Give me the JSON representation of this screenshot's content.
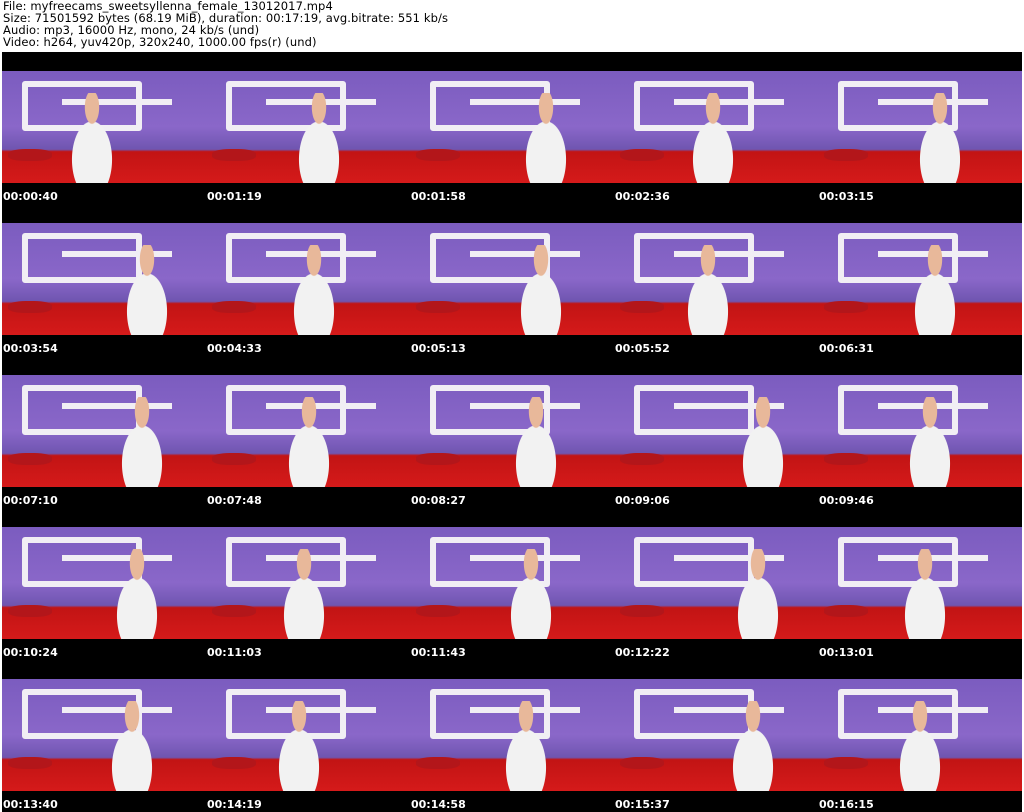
{
  "info": {
    "file": "File: myfreecams_sweetsyllenna_female_13012017.mp4",
    "size": "Size: 71501592 bytes (68.19 MiB), duration: 00:17:19, avg.bitrate: 551 kb/s",
    "audio": "Audio: mp3, 16000 Hz, mono, 24 kb/s (und)",
    "video": "Video: h264, yuv420p, 320x240, 1000.00 fps(r) (und)"
  },
  "thumbnails": [
    {
      "time": "00:00:40"
    },
    {
      "time": "00:01:19"
    },
    {
      "time": "00:01:58"
    },
    {
      "time": "00:02:36"
    },
    {
      "time": "00:03:15"
    },
    {
      "time": "00:03:54"
    },
    {
      "time": "00:04:33"
    },
    {
      "time": "00:05:13"
    },
    {
      "time": "00:05:52"
    },
    {
      "time": "00:06:31"
    },
    {
      "time": "00:07:10"
    },
    {
      "time": "00:07:48"
    },
    {
      "time": "00:08:27"
    },
    {
      "time": "00:09:06"
    },
    {
      "time": "00:09:46"
    },
    {
      "time": "00:10:24"
    },
    {
      "time": "00:11:03"
    },
    {
      "time": "00:11:43"
    },
    {
      "time": "00:12:22"
    },
    {
      "time": "00:13:01"
    },
    {
      "time": "00:13:40"
    },
    {
      "time": "00:14:19"
    },
    {
      "time": "00:14:58"
    },
    {
      "time": "00:15:37"
    },
    {
      "time": "00:16:15"
    }
  ]
}
